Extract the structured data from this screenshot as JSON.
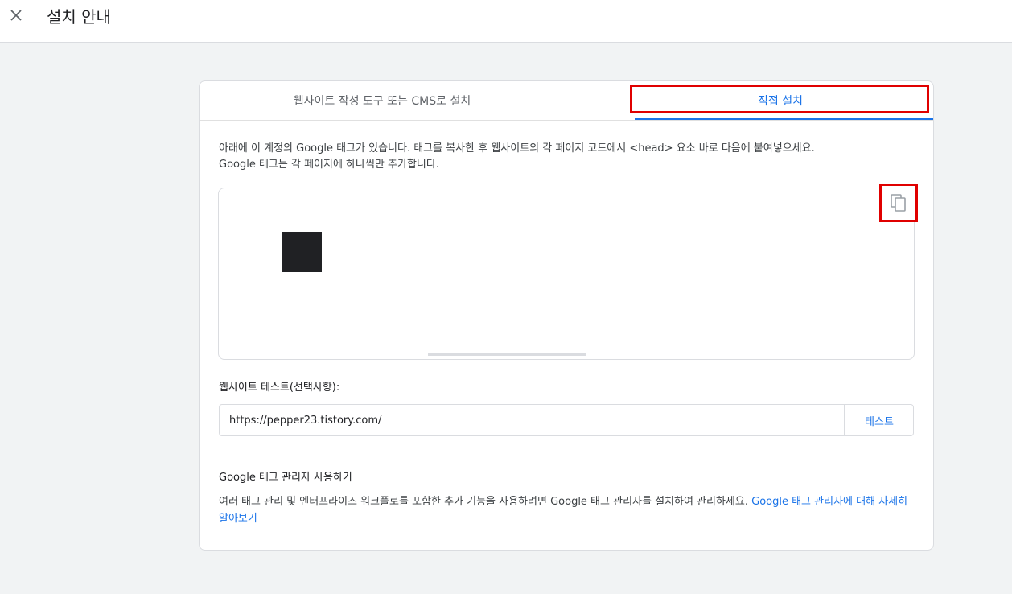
{
  "header": {
    "title": "설치 안내",
    "close_icon": "close-icon"
  },
  "tabs": [
    {
      "label": "웹사이트 작성 도구 또는 CMS로 설치",
      "selected": false
    },
    {
      "label": "직접 설치",
      "selected": true
    }
  ],
  "colors": {
    "accent": "#1a73e8",
    "highlight": "#e00000"
  },
  "instructions": {
    "line1": "아래에 이 계정의 Google 태그가 있습니다. 태그를 복사한 후 웹사이트의 각 페이지 코드에서 <head> 요소 바로 다음에 붙여넣으세요.",
    "line2": "Google 태그는 각 페이지에 하나씩만 추가합니다."
  },
  "code_box": {
    "copy_icon": "copy-icon"
  },
  "site_test": {
    "label": "웹사이트 테스트(선택사항):",
    "url_value": "https://pepper23.tistory.com/",
    "button_label": "테스트"
  },
  "gtm": {
    "title": "Google 태그 관리자 사용하기",
    "description": "여러 태그 관리 및 엔터프라이즈 워크플로를 포함한 추가 기능을 사용하려면 Google 태그 관리자를 설치하여 관리하세요. ",
    "link_text": "Google 태그 관리자에 대해 자세히 알아보기"
  }
}
